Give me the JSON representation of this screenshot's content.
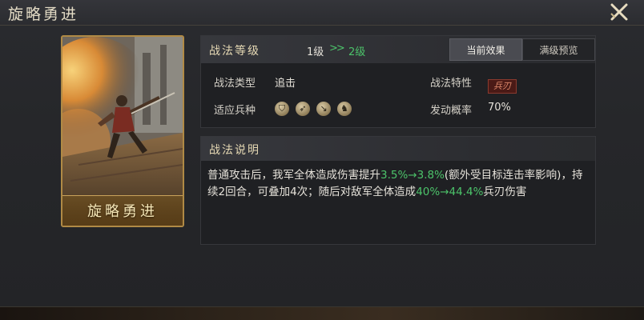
{
  "window": {
    "title": "旋略勇进"
  },
  "card": {
    "name": "旋略勇进"
  },
  "level": {
    "label": "战法等级",
    "from": "1级",
    "arrow": ">>",
    "to": "2级"
  },
  "tabs": [
    {
      "label": "当前效果",
      "active": true
    },
    {
      "label": "满级预览",
      "active": false
    }
  ],
  "props": {
    "type_label": "战法类型",
    "type_value": "追击",
    "trait_label": "战法特性",
    "trait_value": "兵刃",
    "troops_label": "适应兵种",
    "troops": [
      "shield-troop-icon",
      "bow-troop-icon",
      "spear-troop-icon",
      "cavalry-troop-icon"
    ],
    "chance_label": "发动概率",
    "chance_value": "70%"
  },
  "description": {
    "title": "战法说明",
    "p1": "普通攻击后，我军全体造成伤害提升",
    "v1": "3.5%→3.8%",
    "p2": "(额外受目标连击率影响)，持续2回合，可叠加4次；随后对敌军全体造成",
    "v2": "40%→44.4%",
    "p3": "兵刃伤害"
  },
  "colors": {
    "accent_green": "#4cc36a",
    "card_gold": "#b08a45",
    "trait_red": "#e08a6c"
  }
}
